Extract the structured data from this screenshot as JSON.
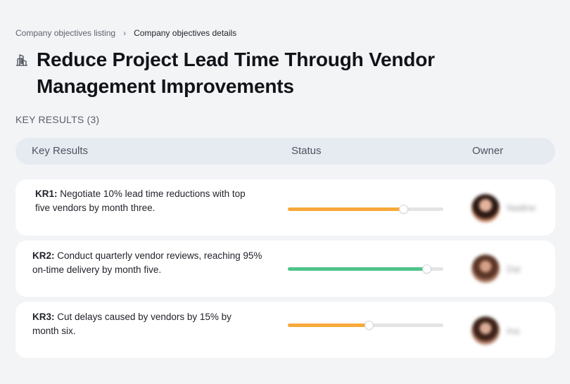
{
  "breadcrumb": {
    "parent": "Company objectives listing",
    "separator": "›",
    "current": "Company objectives details"
  },
  "objective": {
    "title": "Reduce Project Lead Time Through Vendor Management Improvements",
    "icon": "building-icon"
  },
  "key_results_section": {
    "label": "KEY RESULTS (3)"
  },
  "table_header": {
    "key_results": "Key Results",
    "status": "Status",
    "owner": "Owner"
  },
  "key_results": [
    {
      "code": "KR1:",
      "description": "Negotiate 10% lead time reductions with top five vendors by month three.",
      "progress": 0.74,
      "progress_color": "#f8a93a",
      "owner_name": "Nadine"
    },
    {
      "code": "KR2:",
      "description": "Conduct quarterly vendor reviews, reaching 95% on-time delivery by month five.",
      "progress": 0.89,
      "progress_color": "#4fc48a",
      "owner_name": "Dai"
    },
    {
      "code": "KR3:",
      "description": "Cut delays caused by vendors by 15% by month six.",
      "progress": 0.52,
      "progress_color": "#f8a93a",
      "owner_name": "Ina"
    }
  ]
}
